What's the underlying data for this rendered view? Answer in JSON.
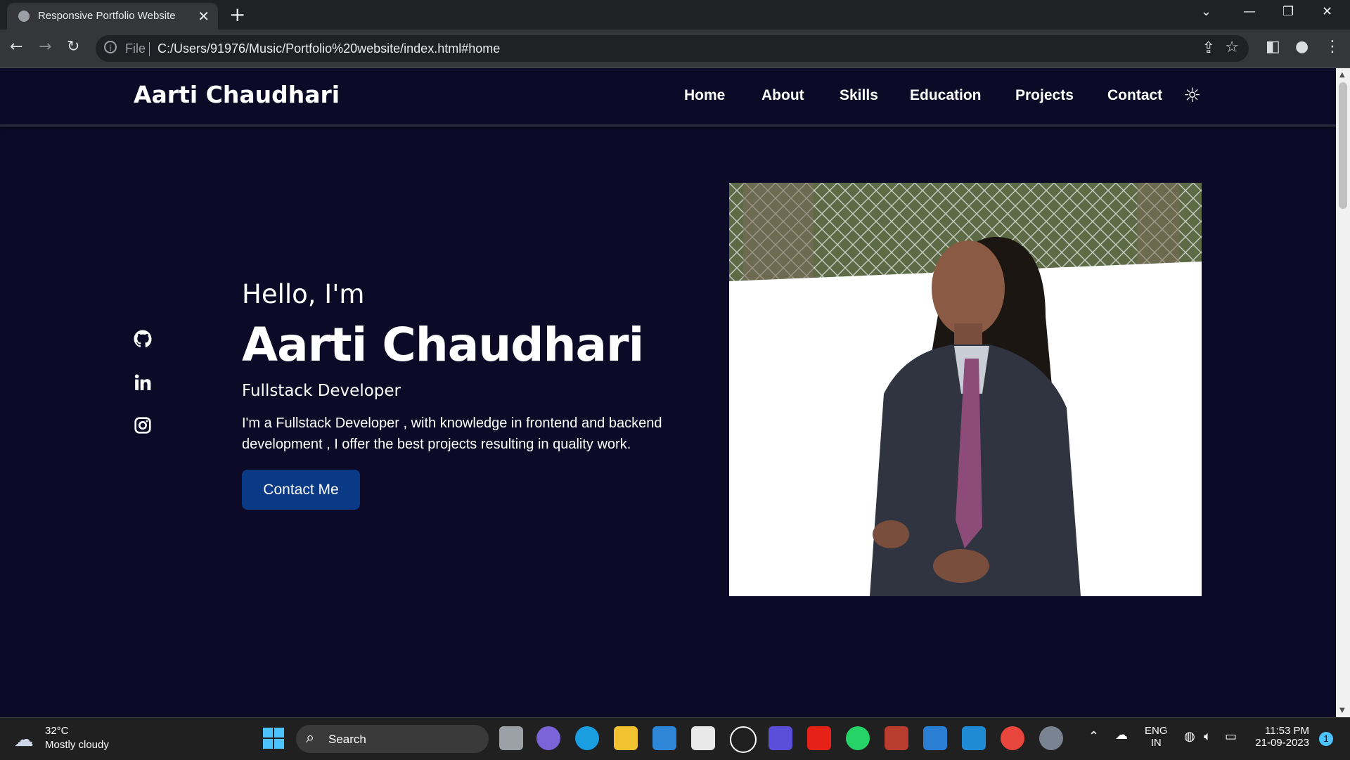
{
  "browser": {
    "tab_title": "Responsive Portfolio Website",
    "close_glyph": "✕",
    "new_tab_glyph": "+",
    "url_scheme": "File",
    "url": "C:/Users/91976/Music/Portfolio%20website/index.html#home",
    "info_glyph": "i"
  },
  "site": {
    "logo": "Aarti Chaudhari",
    "nav": [
      "Home",
      "About",
      "Skills",
      "Education",
      "Projects",
      "Contact"
    ],
    "theme_icon": "sun-icon"
  },
  "hero": {
    "greeting": "Hello, I'm",
    "name": "Aarti Chaudhari",
    "role": "Fullstack Developer",
    "description": "I'm a Fullstack Developer , with knowledge in frontend and backend development , I offer the best projects resulting in quality work.",
    "cta_label": "Contact Me",
    "social": [
      "github-icon",
      "linkedin-icon",
      "instagram-icon"
    ]
  },
  "taskbar": {
    "temperature": "32°C",
    "weather": "Mostly cloudy",
    "search_label": "Search",
    "language": "ENG",
    "region": "IN",
    "time": "11:53 PM",
    "date": "21-09-2023",
    "notification_count": "1"
  },
  "colors": {
    "page_bg": "#0c0a26",
    "button_bg": "#0a3a86",
    "text": "#ffffff"
  }
}
